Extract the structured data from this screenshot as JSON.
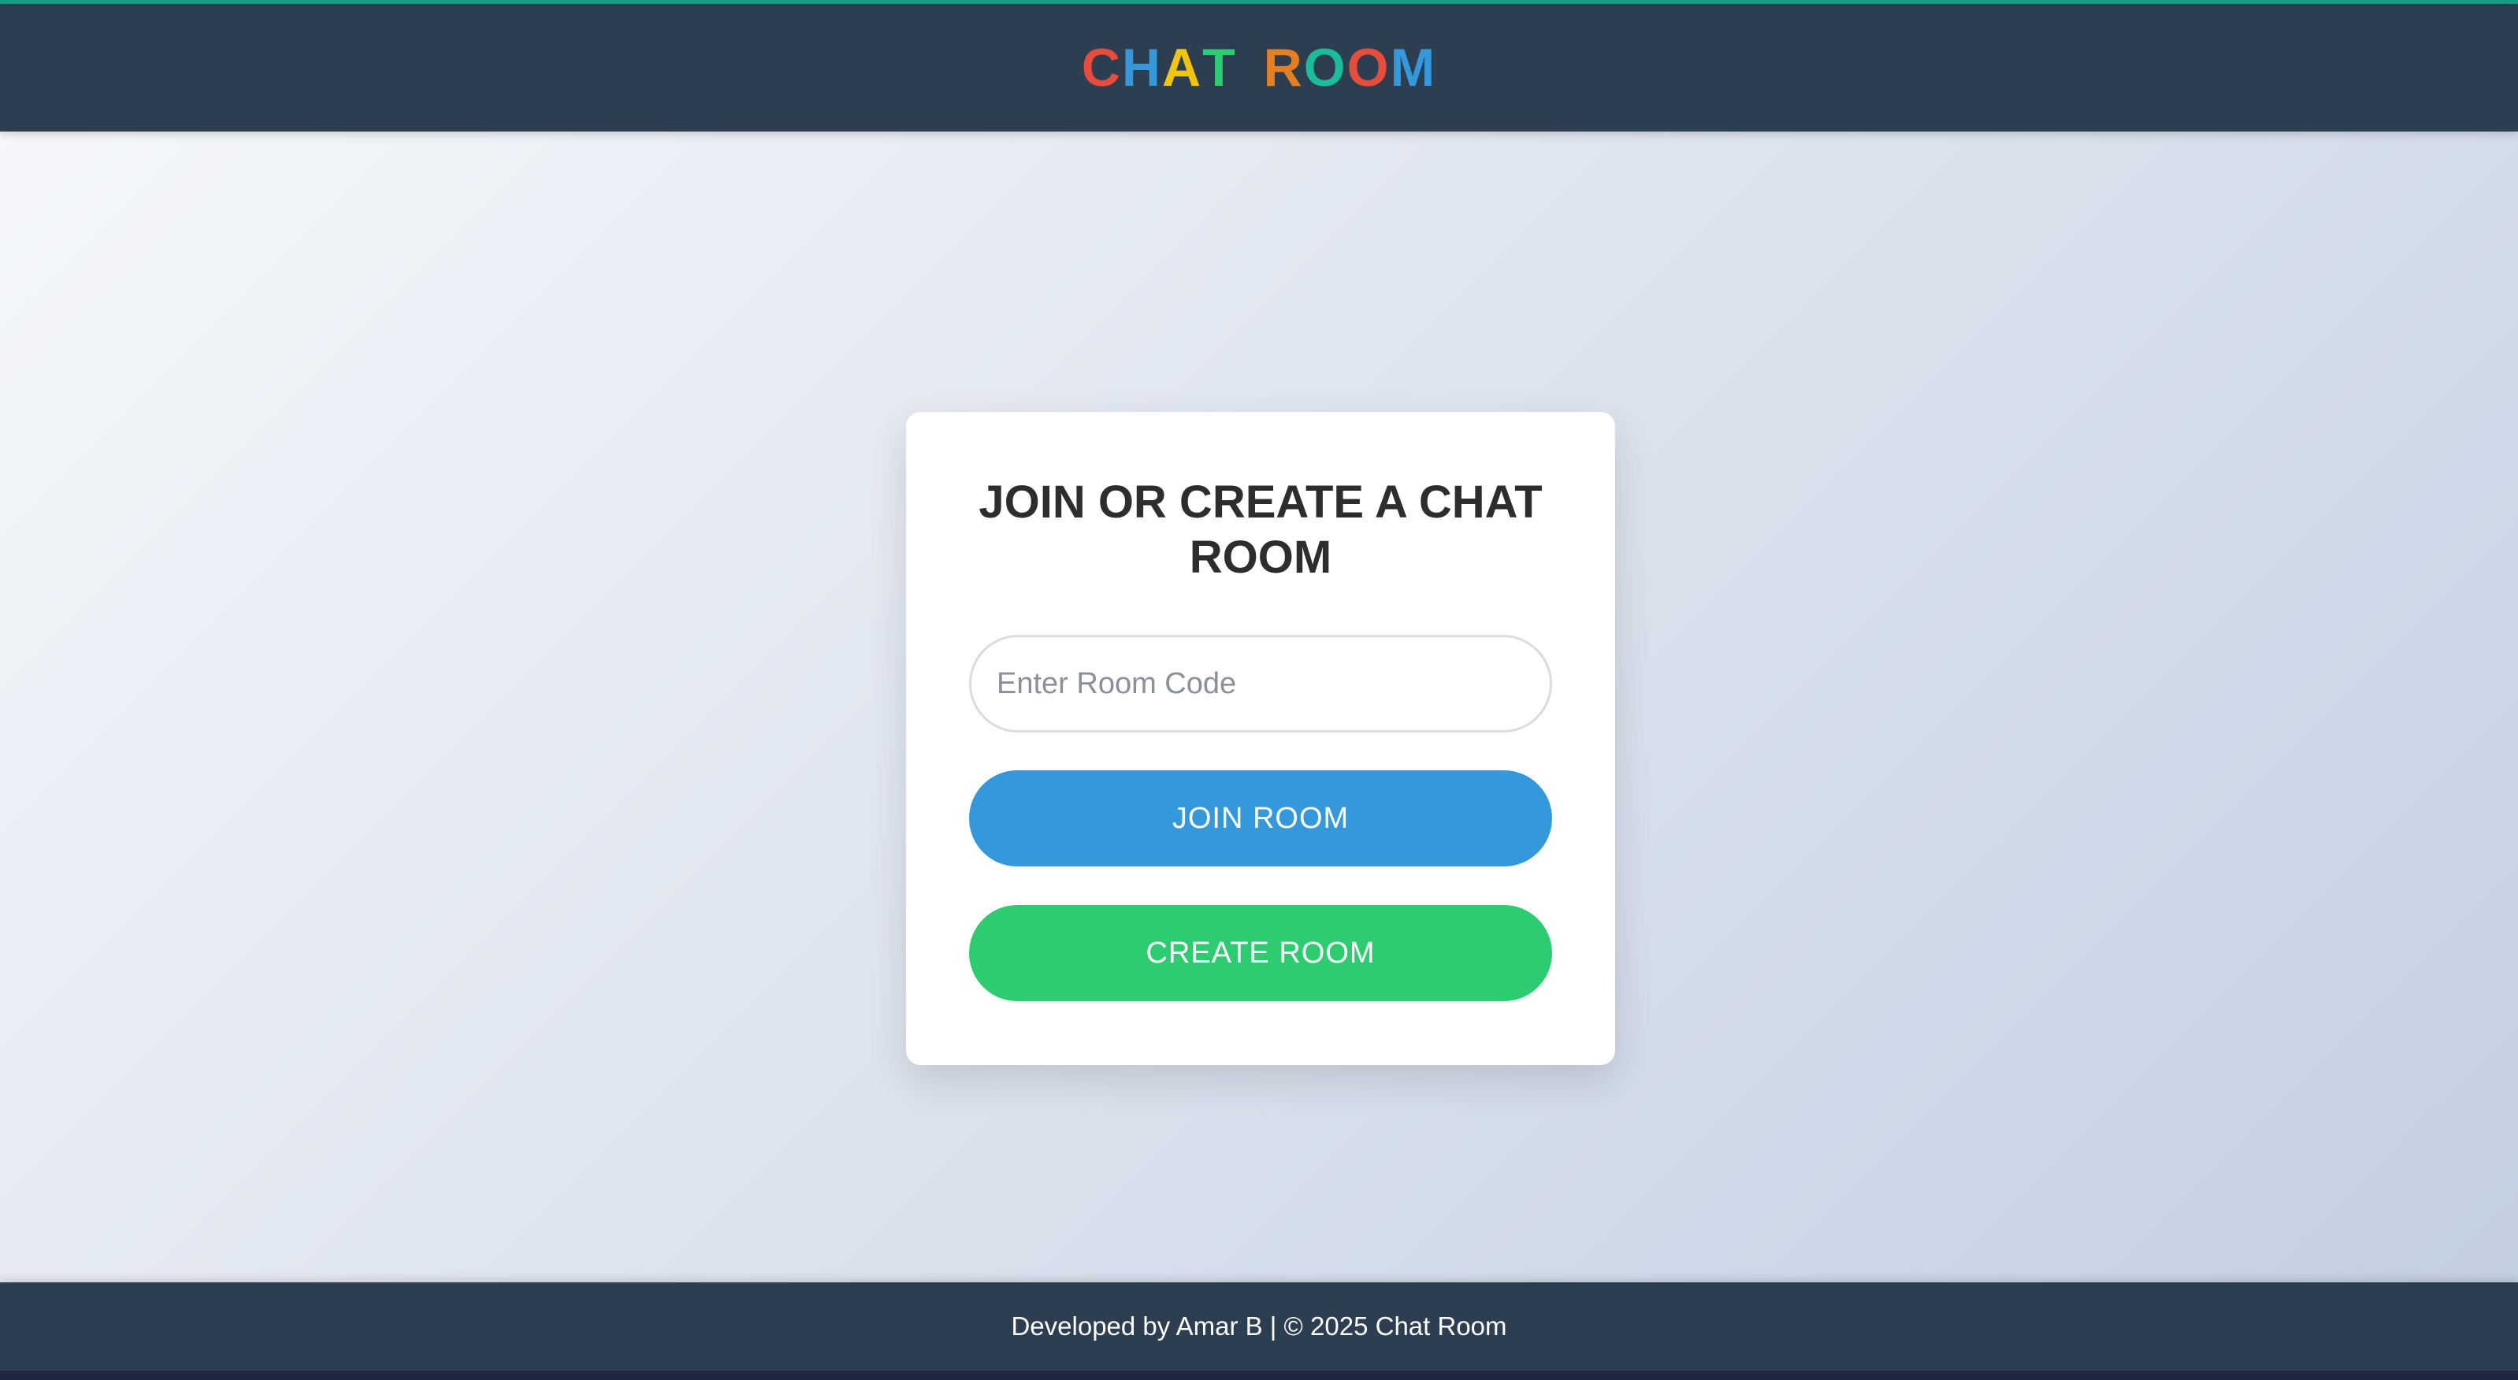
{
  "header": {
    "logo_letters": [
      {
        "char": "C",
        "color": "#e74c3c"
      },
      {
        "char": "H",
        "color": "#3498db"
      },
      {
        "char": "A",
        "color": "#f1c40f"
      },
      {
        "char": "T",
        "color": "#2ecc71"
      },
      {
        "char": " ",
        "color": "#ffffff"
      },
      {
        "char": "R",
        "color": "#e67e22"
      },
      {
        "char": "O",
        "color": "#1abc9c"
      },
      {
        "char": "O",
        "color": "#e74c3c"
      },
      {
        "char": "M",
        "color": "#3498db"
      }
    ]
  },
  "card": {
    "title": "JOIN OR CREATE A CHAT ROOM",
    "room_code_placeholder": "Enter Room Code",
    "room_code_value": "",
    "join_label": "JOIN ROOM",
    "create_label": "CREATE ROOM"
  },
  "footer": {
    "text": "Developed by Amar B | © 2025 Chat Room"
  },
  "colors": {
    "header_bg": "#2c3e50",
    "join_button": "#3498db",
    "create_button": "#2ecc71"
  }
}
